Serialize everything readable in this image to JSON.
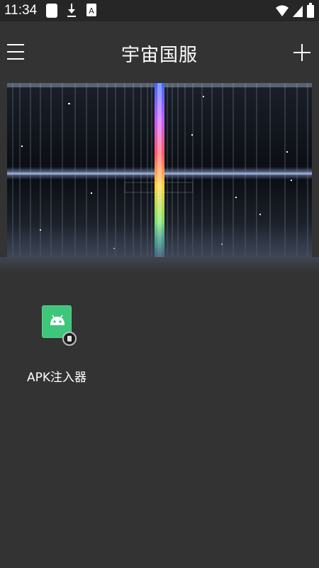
{
  "status_bar": {
    "time": "11:34",
    "left_icons": [
      "note-icon",
      "download-icon",
      "a-icon"
    ],
    "right_icons": [
      "wifi-icon",
      "signal-icon",
      "battery-icon"
    ]
  },
  "app_bar": {
    "title": "宇宙国服",
    "menu_icon": "menu-icon",
    "add_icon": "add-icon"
  },
  "banner": {
    "image": "space-tunnel-banner",
    "colors": {
      "background": "#0d1016",
      "rainbow": [
        "#3b6cff",
        "#c45bff",
        "#ff5a6a",
        "#ffd23f",
        "#8ae15a",
        "#3fd3c8"
      ]
    }
  },
  "apps": [
    {
      "label": "APK注入器",
      "icon": "apk-injector-icon",
      "icon_color": "#3ec77a"
    }
  ]
}
